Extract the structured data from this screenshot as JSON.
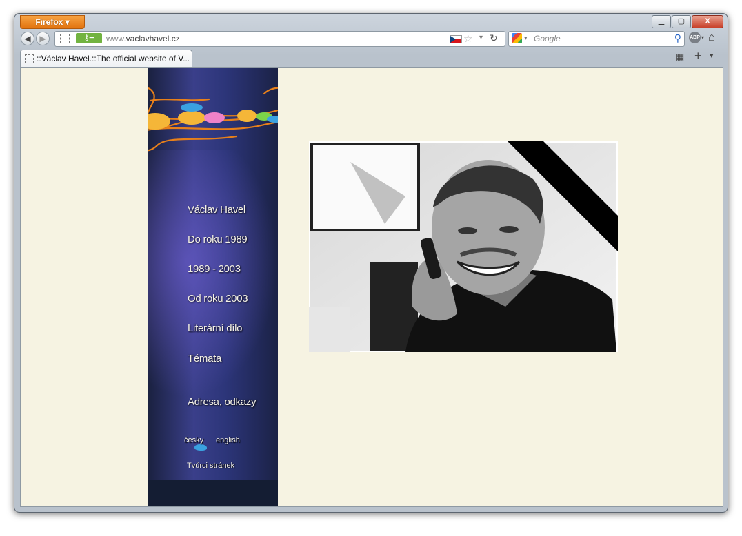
{
  "browser": {
    "menu_button_label": "Firefox",
    "window_controls": {
      "minimize": "▁",
      "maximize": "▢",
      "close": "X"
    },
    "url": {
      "prefix": "www.",
      "domain": "vaclavhavel.cz"
    },
    "search_placeholder": "Google",
    "abp_label": "ABP",
    "tab_title": "::Václav Havel.::The official website of V...",
    "icons": [
      "back-icon",
      "forward-icon",
      "site-identity-icon",
      "key-icon",
      "czech-flag-icon",
      "bookmark-star-icon",
      "reload-icon",
      "google-icon",
      "search-icon",
      "adblock-icon",
      "home-icon",
      "tab-groups-icon",
      "new-tab-icon",
      "list-all-tabs-icon"
    ],
    "colors": {
      "firefox_button": "#e2740f",
      "identity_green": "#72b340",
      "page_background": "#f6f3e2",
      "sidebar": "#2c3579"
    }
  },
  "page": {
    "menu": [
      "Václav Havel",
      "Do roku 1989",
      "1989 - 2003",
      "Od roku 2003",
      "Literární dílo",
      "Témata",
      "Adresa, odkazy"
    ],
    "languages": {
      "czech": "česky",
      "english": "english"
    },
    "credits_link": "Tvůrci stránek"
  }
}
